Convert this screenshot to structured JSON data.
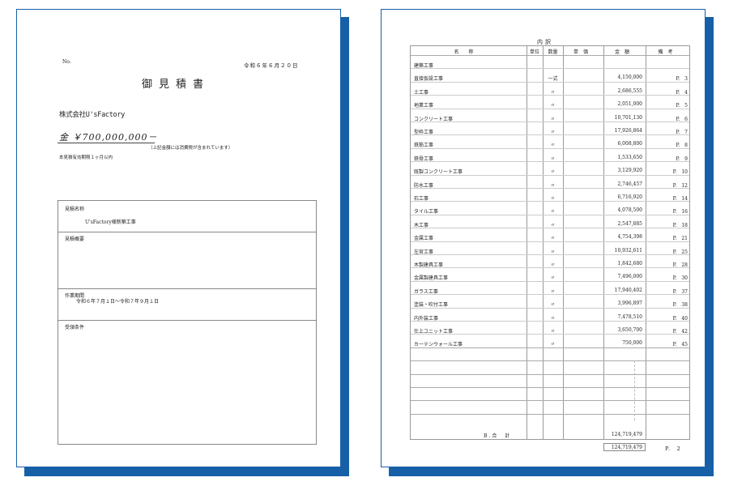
{
  "colors": {
    "accent": "#1760a8"
  },
  "estimate": {
    "no_label": "No.",
    "date": "令和６年６月２０日",
    "title": "御見積書",
    "company": "株式会社U'sFactory",
    "amount": "金 ￥700,000,000－",
    "tax_note": "（上記金額には消費税が含まれています）",
    "validity": "本見積有効期限１ヶ月以内",
    "box": {
      "name_label": "見積名称",
      "name_value": "U'sFactory様新築工事",
      "outline_label": "見積概要",
      "period_label": "作業期間",
      "period_value": "令和６年７月１日～令和７年９月１日",
      "conditions_label": "受領条件"
    }
  },
  "breakdown": {
    "heading": "内訳",
    "columns": [
      "名称",
      "単位",
      "数量",
      "単価",
      "金額",
      "備考"
    ],
    "rows": [
      {
        "name": "建築工事",
        "qty": "",
        "amount": "",
        "note": ""
      },
      {
        "name": "直接仮設工事",
        "qty": "一式",
        "amount": "4,150,000",
        "note": "P.　3"
      },
      {
        "name": "土工事",
        "qty": "〃",
        "amount": "2,686,555",
        "note": "P.　4"
      },
      {
        "name": "地業工事",
        "qty": "〃",
        "amount": "2,051,000",
        "note": "P.　5"
      },
      {
        "name": "コンクリート工事",
        "qty": "〃",
        "amount": "10,701,130",
        "note": "P.　6"
      },
      {
        "name": "型枠工事",
        "qty": "〃",
        "amount": "17,926,864",
        "note": "P.　7"
      },
      {
        "name": "鉄筋工事",
        "qty": "〃",
        "amount": "6,008,800",
        "note": "P.　8"
      },
      {
        "name": "鉄骨工事",
        "qty": "〃",
        "amount": "1,533,650",
        "note": "P.　9"
      },
      {
        "name": "既製コンクリート工事",
        "qty": "〃",
        "amount": "3,129,920",
        "note": "P.　10"
      },
      {
        "name": "防水工事",
        "qty": "〃",
        "amount": "2,746,457",
        "note": "P.　12"
      },
      {
        "name": "石工事",
        "qty": "〃",
        "amount": "6,716,920",
        "note": "P.　14"
      },
      {
        "name": "タイル工事",
        "qty": "〃",
        "amount": "4,078,500",
        "note": "P.　16"
      },
      {
        "name": "木工事",
        "qty": "〃",
        "amount": "2,547,885",
        "note": "P.　18"
      },
      {
        "name": "金属工事",
        "qty": "〃",
        "amount": "4,754,398",
        "note": "P.　21"
      },
      {
        "name": "左官工事",
        "qty": "〃",
        "amount": "10,932,611",
        "note": "P.　25"
      },
      {
        "name": "木製建具工事",
        "qty": "〃",
        "amount": "1,842,680",
        "note": "P.　28"
      },
      {
        "name": "金属製建具工事",
        "qty": "〃",
        "amount": "7,496,000",
        "note": "P.　30"
      },
      {
        "name": "ガラス工事",
        "qty": "〃",
        "amount": "17,940,402",
        "note": "P.　37"
      },
      {
        "name": "塗装・吹付工事",
        "qty": "〃",
        "amount": "3,996,897",
        "note": "P.　38"
      },
      {
        "name": "内外装工事",
        "qty": "〃",
        "amount": "7,478,510",
        "note": "P.　40"
      },
      {
        "name": "仕上ユニット工事",
        "qty": "〃",
        "amount": "3,650,700",
        "note": "P.　42"
      },
      {
        "name": "カーテンウォール工事",
        "qty": "〃",
        "amount": "750,000",
        "note": "P.　45"
      }
    ],
    "subtotal_label": "B.合　計",
    "subtotal_amount": "124,719,479",
    "total_box": "124,719,479",
    "page_number": "P.　2"
  }
}
